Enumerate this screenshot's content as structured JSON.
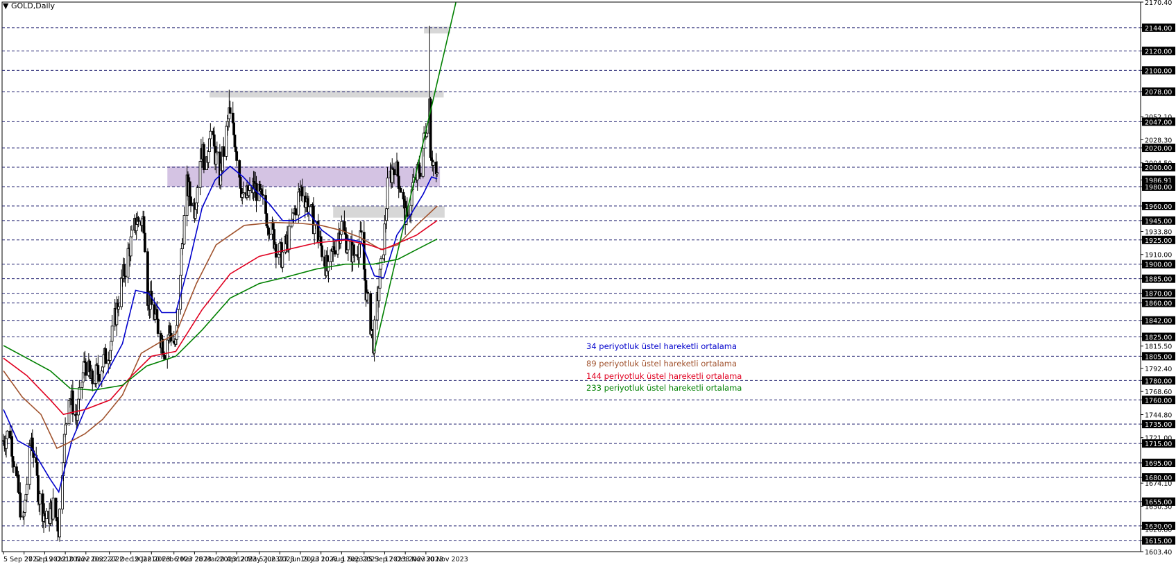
{
  "symbol_label": "▼ GOLD,Daily",
  "chart_data": {
    "type": "candlestick",
    "instrument": "GOLD",
    "timeframe": "Daily",
    "ylim": [
      1603.4,
      2170.4
    ],
    "date_ticks": [
      "5 Sep 2022",
      "27 Sep 2022",
      "19 Oct 2022",
      "10 Nov 2022",
      "2 Dec 2022",
      "27 Dec 2022",
      "19 Jan 2023",
      "10 Feb 2023",
      "6 Mar 2023",
      "28 Mar 2023",
      "20 Apr 2023",
      "12 May 2023",
      "5 Jun 2023",
      "27 Jun 2023",
      "19 Jul 2023",
      "10 Aug 2023",
      "1 Sep 2023",
      "25 Sep 2023",
      "17 Oct 2023",
      "8 Nov 2023",
      "30 Nov 2023"
    ],
    "price_ticks": [
      "2170.40",
      "2144.00",
      "2120.00",
      "2100.00",
      "2078.00",
      "2052.10",
      "2047.00",
      "2028.30",
      "2020.00",
      "2004.50",
      "2000.00",
      "1986.91",
      "1980.00",
      "1960.00",
      "1945.00",
      "1933.80",
      "1925.00",
      "1910.00",
      "1900.00",
      "1885.00",
      "1870.00",
      "1860.00",
      "1842.00",
      "1825.00",
      "1815.50",
      "1805.00",
      "1792.40",
      "1780.00",
      "1768.60",
      "1760.00",
      "1744.80",
      "1735.00",
      "1721.00",
      "1715.00",
      "1695.00",
      "1680.00",
      "1674.10",
      "1655.00",
      "1650.30",
      "1630.00",
      "1626.80",
      "1615.00",
      "1603.40"
    ],
    "highlighted_price_ticks": [
      "2144.00",
      "2120.00",
      "2100.00",
      "2078.00",
      "2047.00",
      "2020.00",
      "2000.00",
      "1986.91",
      "1980.00",
      "1960.00",
      "1945.00",
      "1925.00",
      "1900.00",
      "1885.00",
      "1870.00",
      "1860.00",
      "1842.00",
      "1825.00",
      "1805.00",
      "1780.00",
      "1760.00",
      "1735.00",
      "1715.00",
      "1695.00",
      "1680.00",
      "1655.00",
      "1630.00",
      "1615.00"
    ],
    "current_price": 1986.91,
    "horizontal_levels": [
      2144,
      2120,
      2100,
      2078,
      2047,
      2020,
      2000,
      1980,
      1960,
      1945,
      1925,
      1900,
      1885,
      1870,
      1860,
      1842,
      1825,
      1805,
      1780,
      1760,
      1735,
      1715,
      1695,
      1680,
      1655,
      1630,
      1615
    ],
    "zones": [
      {
        "kind": "gray",
        "from_date": "2023-11-28",
        "to_date": "2023-12-26",
        "low": 2138,
        "high": 2145
      },
      {
        "kind": "gray",
        "from_date": "2023-04-13",
        "to_date": "2023-12-19",
        "low": 2072,
        "high": 2079
      },
      {
        "kind": "purple",
        "from_date": "2023-02-27",
        "to_date": "2023-12-15",
        "low": 1980,
        "high": 2001
      },
      {
        "kind": "gray",
        "from_date": "2023-08-23",
        "to_date": "2023-12-20",
        "low": 1948,
        "high": 1960
      }
    ],
    "trendline": {
      "from_date": "2023-10-06",
      "from_price": 1810,
      "to_date": "2024-01-01",
      "to_price": 2170
    },
    "series": [
      {
        "name": "34 periyotluk üstel hareketli ortalama",
        "color": "#0000cc",
        "points": [
          [
            "2022-09-05",
            1750
          ],
          [
            "2022-09-20",
            1718
          ],
          [
            "2022-10-05",
            1710
          ],
          [
            "2022-10-25",
            1678
          ],
          [
            "2022-11-03",
            1665
          ],
          [
            "2022-11-17",
            1718
          ],
          [
            "2022-12-01",
            1750
          ],
          [
            "2022-12-20",
            1780
          ],
          [
            "2023-01-10",
            1818
          ],
          [
            "2023-01-24",
            1873
          ],
          [
            "2023-02-07",
            1870
          ],
          [
            "2023-02-21",
            1850
          ],
          [
            "2023-03-08",
            1850
          ],
          [
            "2023-03-22",
            1900
          ],
          [
            "2023-04-05",
            1958
          ],
          [
            "2023-04-19",
            1987
          ],
          [
            "2023-05-05",
            2001
          ],
          [
            "2023-05-19",
            1990
          ],
          [
            "2023-06-02",
            1975
          ],
          [
            "2023-06-16",
            1962
          ],
          [
            "2023-06-30",
            1945
          ],
          [
            "2023-07-14",
            1945
          ],
          [
            "2023-07-28",
            1953
          ],
          [
            "2023-08-11",
            1935
          ],
          [
            "2023-08-25",
            1925
          ],
          [
            "2023-09-08",
            1926
          ],
          [
            "2023-09-22",
            1923
          ],
          [
            "2023-10-06",
            1888
          ],
          [
            "2023-10-16",
            1886
          ],
          [
            "2023-10-30",
            1930
          ],
          [
            "2023-11-13",
            1950
          ],
          [
            "2023-11-27",
            1972
          ],
          [
            "2023-12-06",
            1990
          ],
          [
            "2023-12-12",
            1988
          ]
        ]
      },
      {
        "name": "89 periyotluk üstel hareketli ortalama",
        "color": "#a0522d",
        "points": [
          [
            "2022-09-05",
            1790
          ],
          [
            "2022-09-25",
            1763
          ],
          [
            "2022-10-15",
            1745
          ],
          [
            "2022-11-01",
            1710
          ],
          [
            "2022-11-12",
            1715
          ],
          [
            "2022-12-01",
            1725
          ],
          [
            "2022-12-20",
            1740
          ],
          [
            "2023-01-10",
            1765
          ],
          [
            "2023-01-30",
            1808
          ],
          [
            "2023-02-20",
            1820
          ],
          [
            "2023-03-08",
            1828
          ],
          [
            "2023-03-30",
            1880
          ],
          [
            "2023-04-20",
            1920
          ],
          [
            "2023-05-20",
            1940
          ],
          [
            "2023-06-20",
            1943
          ],
          [
            "2023-07-20",
            1942
          ],
          [
            "2023-08-10",
            1940
          ],
          [
            "2023-08-31",
            1935
          ],
          [
            "2023-09-20",
            1928
          ],
          [
            "2023-10-13",
            1915
          ],
          [
            "2023-10-31",
            1920
          ],
          [
            "2023-11-20",
            1940
          ],
          [
            "2023-12-12",
            1960
          ]
        ]
      },
      {
        "name": "144 periyotluk üstel hareketli ortalama",
        "color": "#e00020",
        "points": [
          [
            "2022-09-05",
            1803
          ],
          [
            "2022-09-30",
            1785
          ],
          [
            "2022-10-25",
            1760
          ],
          [
            "2022-11-08",
            1745
          ],
          [
            "2022-12-01",
            1750
          ],
          [
            "2022-12-28",
            1760
          ],
          [
            "2023-01-20",
            1785
          ],
          [
            "2023-02-10",
            1805
          ],
          [
            "2023-03-08",
            1810
          ],
          [
            "2023-04-05",
            1853
          ],
          [
            "2023-05-05",
            1890
          ],
          [
            "2023-06-05",
            1908
          ],
          [
            "2023-07-05",
            1915
          ],
          [
            "2023-08-05",
            1922
          ],
          [
            "2023-09-05",
            1925
          ],
          [
            "2023-09-30",
            1920
          ],
          [
            "2023-10-15",
            1915
          ],
          [
            "2023-11-01",
            1922
          ],
          [
            "2023-11-20",
            1930
          ],
          [
            "2023-12-12",
            1945
          ]
        ]
      },
      {
        "name": "233 periyotluk üstel hareketli ortalama",
        "color": "#008000",
        "points": [
          [
            "2022-09-05",
            1816
          ],
          [
            "2022-09-30",
            1803
          ],
          [
            "2022-10-25",
            1790
          ],
          [
            "2022-11-15",
            1772
          ],
          [
            "2022-12-10",
            1770
          ],
          [
            "2023-01-10",
            1775
          ],
          [
            "2023-02-05",
            1795
          ],
          [
            "2023-03-08",
            1805
          ],
          [
            "2023-04-05",
            1832
          ],
          [
            "2023-05-05",
            1865
          ],
          [
            "2023-06-05",
            1880
          ],
          [
            "2023-07-05",
            1887
          ],
          [
            "2023-08-05",
            1895
          ],
          [
            "2023-09-05",
            1900
          ],
          [
            "2023-10-05",
            1900
          ],
          [
            "2023-10-31",
            1905
          ],
          [
            "2023-11-20",
            1915
          ],
          [
            "2023-12-12",
            1926
          ]
        ]
      }
    ],
    "candle_path": [
      [
        "2022-09-05",
        1718
      ],
      [
        "2022-09-12",
        1728
      ],
      [
        "2022-09-20",
        1670
      ],
      [
        "2022-09-26",
        1630
      ],
      [
        "2022-09-30",
        1675
      ],
      [
        "2022-10-05",
        1722
      ],
      [
        "2022-10-13",
        1660
      ],
      [
        "2022-10-21",
        1635
      ],
      [
        "2022-10-28",
        1650
      ],
      [
        "2022-11-03",
        1628
      ],
      [
        "2022-11-08",
        1708
      ],
      [
        "2022-11-14",
        1770
      ],
      [
        "2022-11-22",
        1740
      ],
      [
        "2022-12-01",
        1800
      ],
      [
        "2022-12-08",
        1778
      ],
      [
        "2022-12-16",
        1790
      ],
      [
        "2022-12-28",
        1815
      ],
      [
        "2023-01-06",
        1865
      ],
      [
        "2023-01-16",
        1910
      ],
      [
        "2023-01-25",
        1945
      ],
      [
        "2023-02-02",
        1945
      ],
      [
        "2023-02-06",
        1868
      ],
      [
        "2023-02-14",
        1845
      ],
      [
        "2023-02-24",
        1812
      ],
      [
        "2023-03-01",
        1832
      ],
      [
        "2023-03-08",
        1815
      ],
      [
        "2023-03-14",
        1910
      ],
      [
        "2023-03-20",
        1980
      ],
      [
        "2023-03-28",
        1958
      ],
      [
        "2023-04-04",
        2022
      ],
      [
        "2023-04-10",
        1998
      ],
      [
        "2023-04-13",
        2040
      ],
      [
        "2023-04-24",
        1990
      ],
      [
        "2023-05-04",
        2055
      ],
      [
        "2023-05-10",
        2030
      ],
      [
        "2023-05-19",
        1965
      ],
      [
        "2023-05-31",
        1980
      ],
      [
        "2023-06-09",
        1962
      ],
      [
        "2023-06-23",
        1920
      ],
      [
        "2023-06-29",
        1908
      ],
      [
        "2023-07-07",
        1928
      ],
      [
        "2023-07-14",
        1960
      ],
      [
        "2023-07-20",
        1978
      ],
      [
        "2023-07-28",
        1960
      ],
      [
        "2023-08-08",
        1925
      ],
      [
        "2023-08-18",
        1890
      ],
      [
        "2023-08-24",
        1918
      ],
      [
        "2023-09-01",
        1940
      ],
      [
        "2023-09-08",
        1918
      ],
      [
        "2023-09-14",
        1910
      ],
      [
        "2023-09-22",
        1925
      ],
      [
        "2023-09-28",
        1864
      ],
      [
        "2023-10-05",
        1820
      ],
      [
        "2023-10-09",
        1860
      ],
      [
        "2023-10-16",
        1920
      ],
      [
        "2023-10-20",
        1978
      ],
      [
        "2023-10-27",
        2005
      ],
      [
        "2023-11-02",
        1985
      ],
      [
        "2023-11-10",
        1940
      ],
      [
        "2023-11-16",
        1980
      ],
      [
        "2023-11-24",
        2000
      ],
      [
        "2023-11-30",
        2040
      ],
      [
        "2023-12-04",
        2070
      ],
      [
        "2023-12-05",
        2020
      ],
      [
        "2023-12-08",
        2005
      ],
      [
        "2023-12-12",
        1986
      ]
    ],
    "spikes": [
      {
        "date": "2023-12-04",
        "high": 2146
      },
      {
        "date": "2023-05-04",
        "high": 2080
      }
    ]
  },
  "legend": [
    {
      "label": "34 periyotluk üstel hareketli ortalama",
      "color": "#0000cc"
    },
    {
      "label": "89 periyotluk üstel hareketli ortalama",
      "color": "#a0522d"
    },
    {
      "label": "144 periyotluk üstel hareketli ortalama",
      "color": "#e00020"
    },
    {
      "label": "233 periyotluk üstel hareketli ortalama",
      "color": "#008000"
    }
  ],
  "colors": {
    "grid": "#1f1f6e",
    "axis_highlight": "#000000",
    "zone_gray": "#d3d3d3",
    "zone_purple": "#cdb8de",
    "trend": "#008000"
  }
}
